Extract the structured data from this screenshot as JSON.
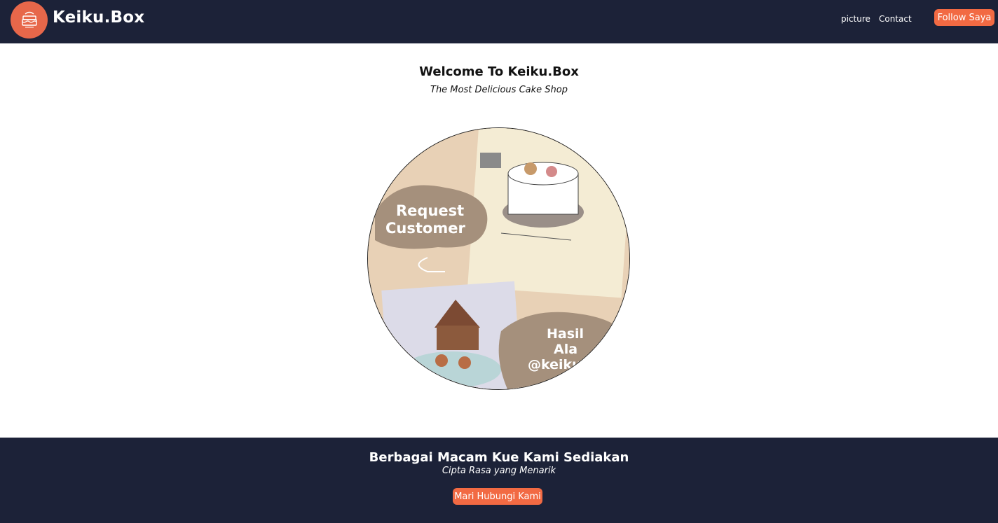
{
  "navbar": {
    "brand": "Keiku.Box",
    "logo_icon": "cake-logo-icon",
    "links": [
      "picture",
      "Contact"
    ],
    "follow_label": "Follow Saya"
  },
  "hero": {
    "title": "Welcome To Keiku.Box",
    "subtitle": "The Most Delicious Cake Shop",
    "image_text_1": "Request",
    "image_text_2": "Customer",
    "image_text_3": "Hasil",
    "image_text_4": "Ala",
    "image_text_5": "@keiku"
  },
  "footer": {
    "title": "Berbagai Macam Kue Kami Sediakan",
    "subtitle": "Cipta Rasa yang Menarik",
    "contact_label": "Mari Hubungi Kami"
  },
  "colors": {
    "navy": "#1c2238",
    "accent": "#f26a43",
    "logo_bg": "#e7674a"
  }
}
